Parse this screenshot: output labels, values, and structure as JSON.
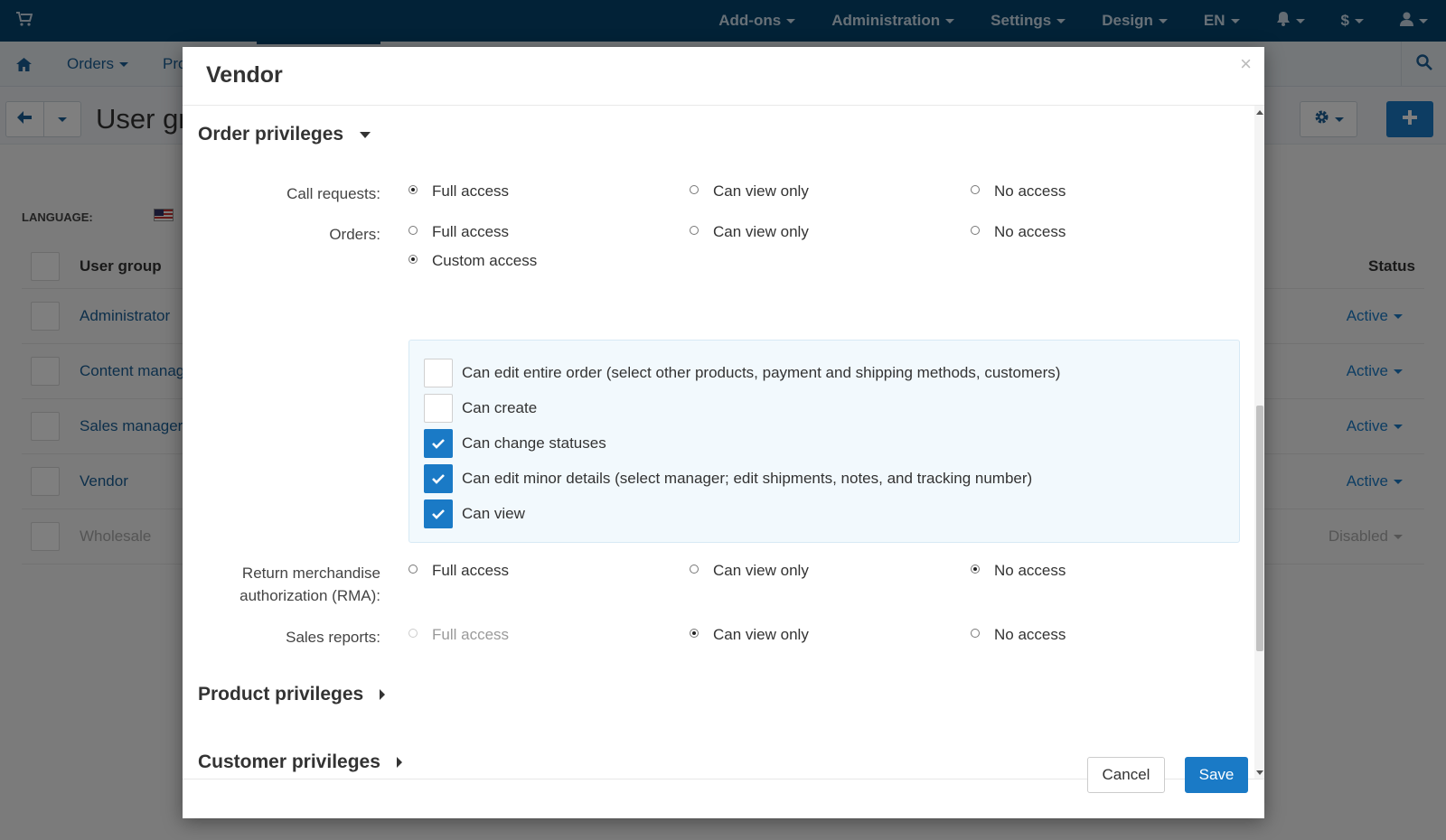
{
  "colors": {
    "topbar": "#04446e",
    "accent": "#1a7ac6",
    "link": "#1a5f96",
    "custom_box": "#f2f9fd"
  },
  "topnav": {
    "items": [
      {
        "label": "Add-ons",
        "caret": true
      },
      {
        "label": "Administration",
        "caret": true
      },
      {
        "label": "Settings",
        "caret": true
      },
      {
        "label": "Design",
        "caret": true
      },
      {
        "label": "EN",
        "caret": true
      }
    ],
    "icons": [
      "cart-icon",
      "bell-icon",
      "dollar-icon",
      "user-icon"
    ],
    "currency_symbol": "$"
  },
  "subnav": {
    "orders_label": "Orders",
    "products_label_partial": "Pro"
  },
  "page": {
    "title": "User gr",
    "language_label": "LANGUAGE:"
  },
  "user_groups": {
    "header": {
      "name": "User group",
      "status": "Status"
    },
    "rows": [
      {
        "name": "Administrator",
        "status": "Active",
        "disabled": false
      },
      {
        "name": "Content manag",
        "status": "Active",
        "disabled": false
      },
      {
        "name": "Sales manager",
        "status": "Active",
        "disabled": false
      },
      {
        "name": "Vendor",
        "status": "Active",
        "disabled": false
      },
      {
        "name": "Wholesale",
        "status": "Disabled",
        "disabled": true
      }
    ]
  },
  "modal": {
    "title": "Vendor",
    "close_symbol": "×",
    "sections": {
      "order": "Order privileges",
      "product": "Product privileges",
      "customer": "Customer privileges"
    },
    "options": {
      "full": "Full access",
      "view": "Can view only",
      "none": "No access",
      "custom": "Custom access"
    },
    "fields": {
      "call_requests": {
        "label": "Call requests:",
        "selected": "full"
      },
      "orders": {
        "label": "Orders:",
        "selected": "custom"
      },
      "rma": {
        "label_line1": "Return merchandise",
        "label_line2": "authorization (RMA):",
        "selected": "none"
      },
      "sales_reports": {
        "label": "Sales reports:",
        "selected": "view",
        "full_disabled": true
      }
    },
    "custom_permissions": [
      {
        "label": "Can edit entire order (select other products, payment and shipping methods, customers)",
        "checked": false
      },
      {
        "label": "Can create",
        "checked": false
      },
      {
        "label": "Can change statuses",
        "checked": true
      },
      {
        "label": "Can edit minor details (select manager; edit shipments, notes, and tracking number)",
        "checked": true
      },
      {
        "label": "Can view",
        "checked": true
      }
    ],
    "footer": {
      "cancel": "Cancel",
      "save": "Save"
    }
  }
}
